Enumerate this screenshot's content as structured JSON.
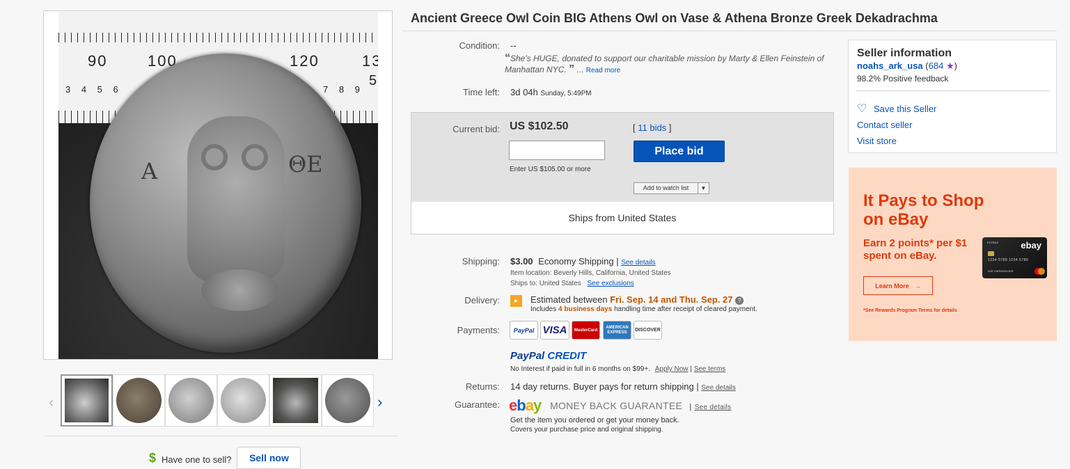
{
  "listing": {
    "title": "Ancient Greece Owl Coin BIG Athens Owl on Vase & Athena Bronze Greek Dekadrachma",
    "condition_label": "Condition:",
    "condition_value": "--",
    "quote": "She's HUGE, donated to support our charitable mission by Marty & Ellen Feinstein of Manhattan NYC.",
    "quote_open": "“",
    "quote_close": "”",
    "read_more": "Read more",
    "ellipsis": "...",
    "time_left_label": "Time left:",
    "time_left_value": "3d 04h",
    "time_left_end": "Sunday, 5:49PM"
  },
  "image": {
    "ruler_numbers": [
      "90",
      "100",
      "120",
      "13"
    ],
    "ruler_small": "3 4 5 6",
    "ruler_small2": "7 8 9",
    "ruler_five": "5",
    "coin_letters": [
      "Α",
      "ΘΕ"
    ]
  },
  "bid": {
    "current_label": "Current bid:",
    "current_value": "US $102.50",
    "bids_text": "11 bids",
    "bracket_open": "[",
    "bracket_close": "]",
    "enter_text": "Enter US $105.00 or more",
    "place_bid": "Place bid",
    "watch_label": "Add to watch list",
    "ships_from": "Ships from United States"
  },
  "shipping": {
    "label": "Shipping:",
    "cost": "$3.00",
    "method": "Economy Shipping",
    "see_details": "See details",
    "location": "Item location:   Beverly Hills, California, United States",
    "ships_to_label": "Ships to:   United States",
    "see_exclusions": "See exclusions"
  },
  "delivery": {
    "label": "Delivery:",
    "estimated": "Estimated between",
    "dates": "Fri. Sep. 14 and Thu. Sep. 27",
    "includes": "Includes",
    "business_days": "4 business days",
    "handling": "handling time after receipt of cleared payment."
  },
  "payments": {
    "label": "Payments:",
    "methods": [
      "PayPal",
      "VISA",
      "MasterCard",
      "AMERICAN EXPRESS",
      "DISCOVER"
    ],
    "credit_paypal": "PayPal",
    "credit_word": "CREDIT",
    "credit_text": "No Interest if paid in full in 6 months on $99+.",
    "apply_now": "Apply Now",
    "see_terms": "See terms"
  },
  "returns": {
    "label": "Returns:",
    "text": "14 day returns. Buyer pays for return shipping",
    "see_details": "See details"
  },
  "guarantee": {
    "label": "Guarantee:",
    "brand": "ebay",
    "title": "MONEY BACK GUARANTEE",
    "see_details": "See details",
    "line1": "Get the item you ordered or get your money back.",
    "line2": "Covers your purchase price and original shipping."
  },
  "seller": {
    "heading": "Seller information",
    "name": "noahs_ark_usa",
    "score": "684",
    "feedback": "98.2% Positive feedback",
    "save": "Save this Seller",
    "contact": "Contact seller",
    "visit": "Visit store"
  },
  "ad": {
    "headline": "It Pays to Shop on eBay",
    "sub": "Earn 2 points* per $1 spent on eBay.",
    "button": "Learn More",
    "fine": "*See Rewards Program Terms for details",
    "card_top": "EXTRAS",
    "card_brand": "ebay",
    "card_number": "1234 5789 1234 5789",
    "card_name": "LEE CARDHOLDER"
  },
  "sell": {
    "question": "Have one to sell?",
    "button": "Sell now"
  },
  "colors": {
    "link": "#0654ba",
    "accent_orange": "#dd3a0e",
    "delivery_date": "#c45500",
    "green": "#5ba71b"
  }
}
